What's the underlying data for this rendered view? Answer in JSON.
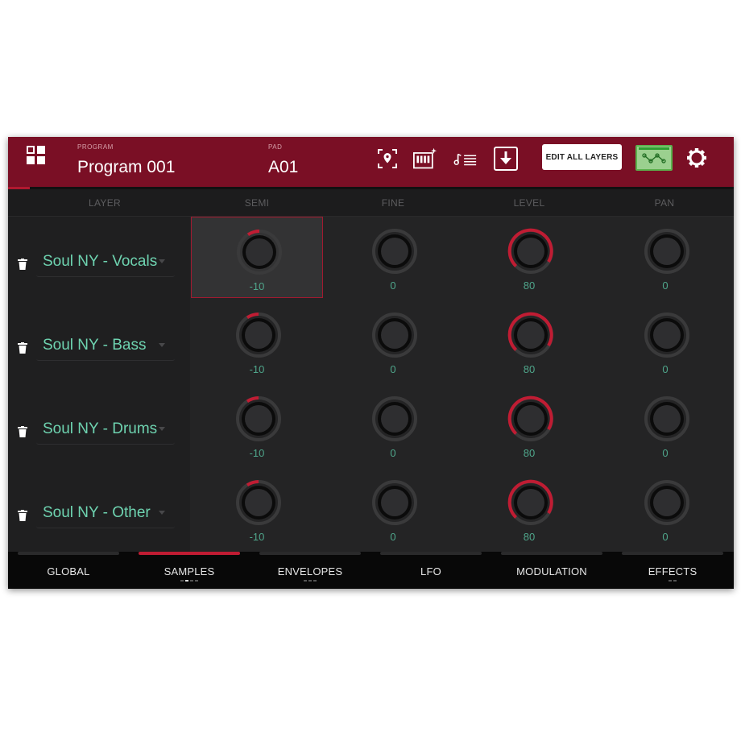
{
  "header": {
    "program_label": "PROGRAM",
    "program_value": "Program 001",
    "pad_label": "PAD",
    "pad_value": "A01",
    "edit_all_label": "EDIT ALL LAYERS",
    "icons": [
      "grid-menu-icon",
      "pad-locate-icon",
      "keyboard-icon",
      "note-list-icon",
      "download-icon",
      "envelope-graph-icon",
      "gear-icon"
    ]
  },
  "columns": [
    "LAYER",
    "SEMI",
    "FINE",
    "LEVEL",
    "PAN"
  ],
  "layers": [
    {
      "name": "Soul NY - Vocals",
      "semi": "-10",
      "fine": "0",
      "level": "80",
      "pan": "0"
    },
    {
      "name": "Soul NY - Bass",
      "semi": "-10",
      "fine": "0",
      "level": "80",
      "pan": "0"
    },
    {
      "name": "Soul NY - Drums",
      "semi": "-10",
      "fine": "0",
      "level": "80",
      "pan": "0"
    },
    {
      "name": "Soul NY - Other",
      "semi": "-10",
      "fine": "0",
      "level": "80",
      "pan": "0"
    }
  ],
  "tabs": [
    {
      "label": "GLOBAL"
    },
    {
      "label": "SAMPLES"
    },
    {
      "label": "ENVELOPES"
    },
    {
      "label": "LFO"
    },
    {
      "label": "MODULATION"
    },
    {
      "label": "EFFECTS"
    }
  ],
  "active_tab": "SAMPLES",
  "colors": {
    "accent": "#c01c33",
    "header_bg": "#7a0f25",
    "value_text": "#4fa68b",
    "layer_text": "#6ed3b0",
    "graph_button": "#9bd08f"
  }
}
